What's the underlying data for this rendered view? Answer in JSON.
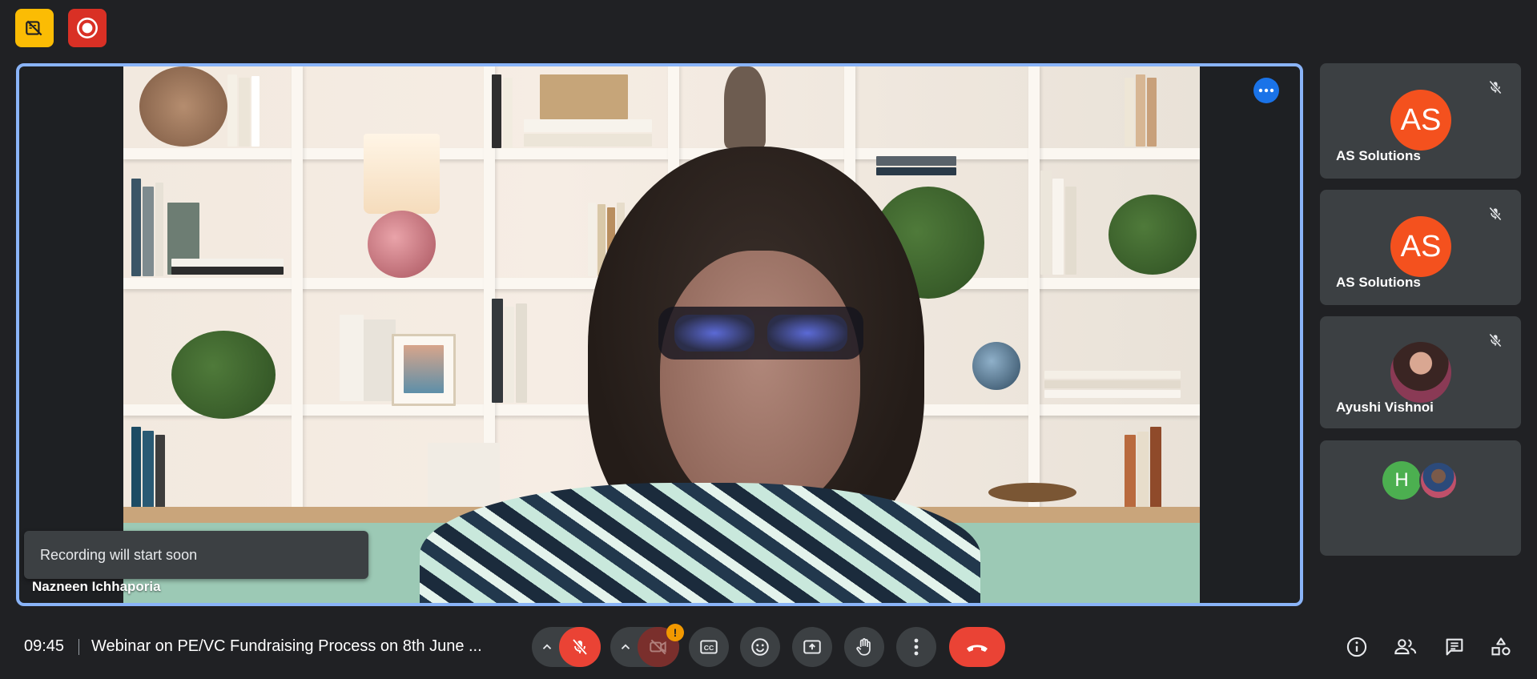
{
  "top_indicators": [
    {
      "icon": "no-video-icon",
      "color": "#fbbc04"
    },
    {
      "icon": "recording-icon",
      "color": "#d93025"
    }
  ],
  "main_tile": {
    "participant_name": "Nazneen Ichhaporia",
    "toast": "Recording will start soon"
  },
  "side_tiles": [
    {
      "initials": "AS",
      "name": "AS Solutions",
      "muted": true,
      "avatar_color": "#f4511e"
    },
    {
      "initials": "AS",
      "name": "AS Solutions",
      "muted": true,
      "avatar_color": "#f4511e"
    },
    {
      "name": "Ayushi Vishnoi",
      "muted": true
    },
    {
      "others": [
        {
          "initial": "H",
          "color": "#4caf50"
        }
      ]
    }
  ],
  "bottom_bar": {
    "time": "09:45",
    "meeting_title": "Webinar on PE/VC Fundraising Process on 8th June ...",
    "controls": [
      "chevron-up-icon",
      "mic-off-icon",
      "chevron-up-icon",
      "camera-off-icon",
      "captions-icon",
      "emoji-icon",
      "present-icon",
      "raise-hand-icon",
      "more-options-icon",
      "leave-call-icon"
    ],
    "camera_alert_badge": "!",
    "right_icons": [
      "info-icon",
      "people-icon",
      "chat-icon",
      "activities-icon"
    ]
  },
  "colors": {
    "background": "#202124",
    "active_border": "#8ab4f8",
    "end_call": "#ea4335"
  }
}
